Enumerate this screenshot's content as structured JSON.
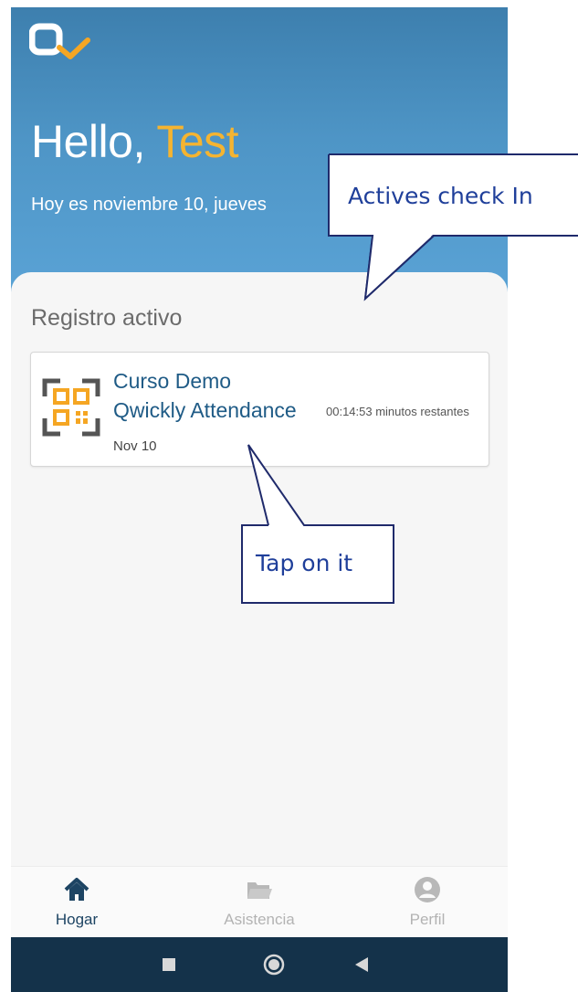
{
  "header": {
    "greeting": "Hello,",
    "user_name": "Test",
    "date_text": "Hoy es noviembre 10, jueves"
  },
  "section": {
    "title": "Registro activo"
  },
  "active_checkin": {
    "course_name": "Curso Demo",
    "course_subtitle": "Qwickly Attendance",
    "time_remaining": "00:14:53 minutos restantes",
    "date": "Nov 10",
    "icon": "qr-code-icon"
  },
  "bottom_nav": {
    "items": [
      {
        "label": "Hogar",
        "icon": "home-icon",
        "active": true
      },
      {
        "label": "Asistencia",
        "icon": "folder-icon",
        "active": false
      },
      {
        "label": "Perfil",
        "icon": "profile-icon",
        "active": false
      }
    ]
  },
  "annotations": {
    "callout_checkin": "Actives check In",
    "callout_tap": "Tap on it"
  },
  "colors": {
    "accent": "#f5b430",
    "primary_text": "#1f5b86",
    "header_gradient_top": "#3d7fae",
    "header_gradient_bottom": "#5aa3d6",
    "system_bar": "#14324a",
    "callout_border": "#1f2a6b"
  }
}
